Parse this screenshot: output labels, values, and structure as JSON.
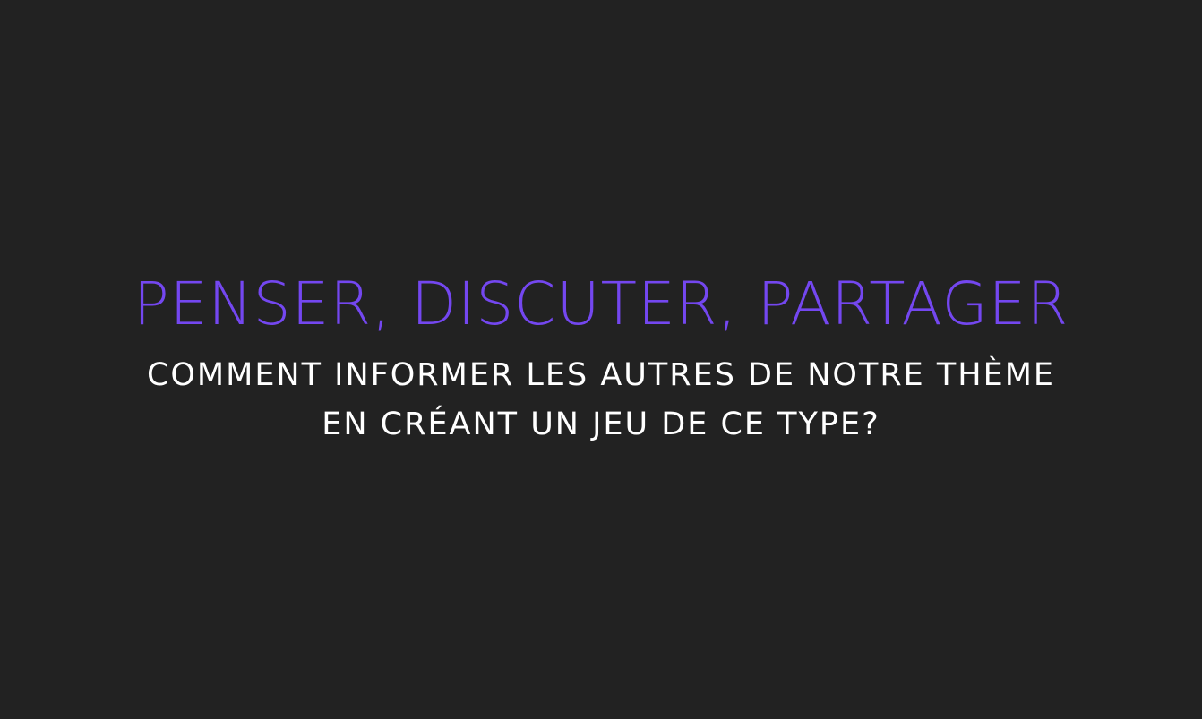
{
  "slide": {
    "title": "PENSER, DISCUTER, PARTAGER",
    "subtitle_lines": [
      "COMMENT INFORMER LES AUTRES DE NOTRE THÈME",
      "EN CRÉANT UN JEU DE CE TYPE?"
    ]
  },
  "colors": {
    "background": "#222222",
    "title": "#7447f0",
    "subtitle": "#ffffff"
  }
}
